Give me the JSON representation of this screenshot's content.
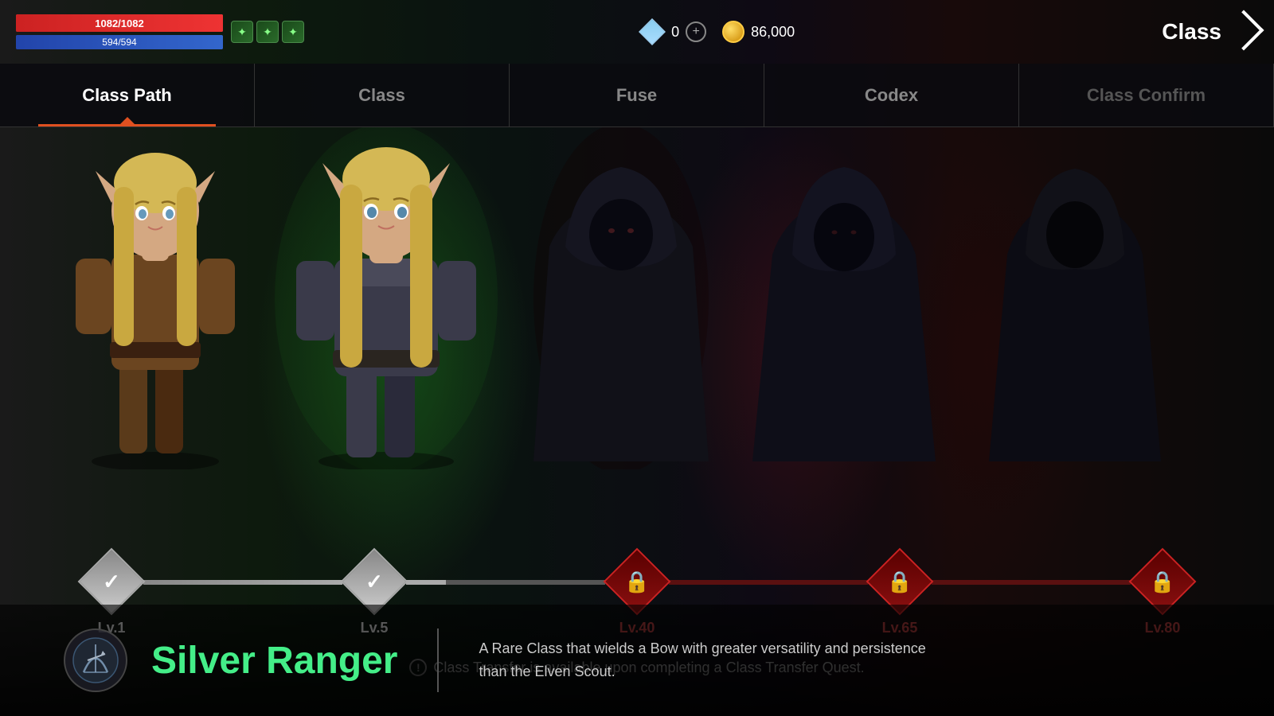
{
  "topRight": {
    "label": "Class",
    "arrow": "→"
  },
  "hud": {
    "hp": "1082/1082",
    "mp": "594/594",
    "diamonds": "0",
    "gold": "86,000",
    "plusLabel": "+"
  },
  "tabs": [
    {
      "id": "class-path",
      "label": "Class Path",
      "active": true
    },
    {
      "id": "class",
      "label": "Class",
      "active": false
    },
    {
      "id": "fuse",
      "label": "Fuse",
      "active": false
    },
    {
      "id": "codex",
      "label": "Codex",
      "active": false
    },
    {
      "id": "class-confirm",
      "label": "Class Confirm",
      "active": false
    }
  ],
  "nodes": [
    {
      "id": "lv1",
      "label": "Lv.1",
      "state": "unlocked"
    },
    {
      "id": "lv5",
      "label": "Lv.5",
      "state": "unlocked"
    },
    {
      "id": "lv40",
      "label": "Lv.40",
      "state": "locked"
    },
    {
      "id": "lv65",
      "label": "Lv.65",
      "state": "locked"
    },
    {
      "id": "lv80",
      "label": "Lv.80",
      "state": "locked"
    }
  ],
  "infoMessage": "Class Transfer is available upon completing a Class Transfer Quest.",
  "className": "Silver Ranger",
  "classDescription": "A Rare Class that wields a Bow with greater versatility and persistence than the Elven Scout."
}
